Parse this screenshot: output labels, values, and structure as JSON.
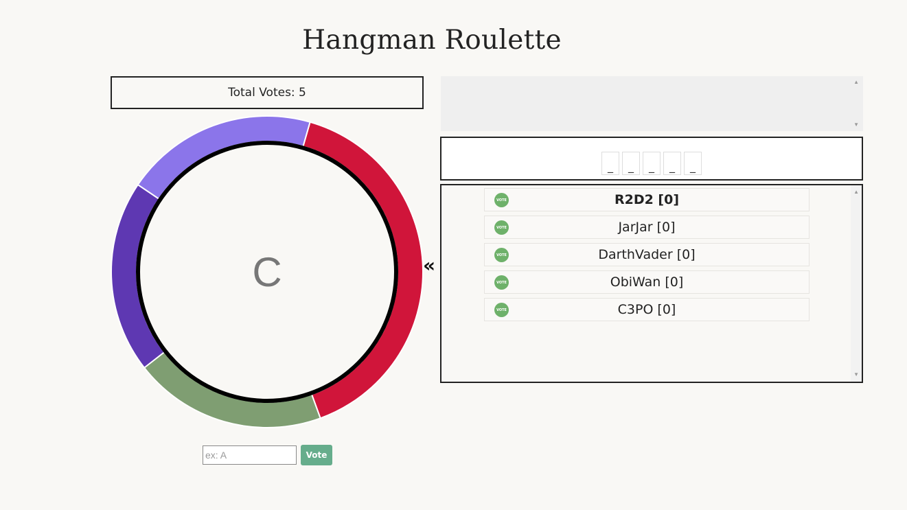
{
  "app": {
    "title": "Hangman Roulette"
  },
  "votes": {
    "total_label": "Total Votes: 5"
  },
  "wheel": {
    "current_letter": "C",
    "segments": [
      {
        "color": "#d0153a",
        "share": 0.4
      },
      {
        "color": "#7f9e72",
        "share": 0.2
      },
      {
        "color": "#5e38b2",
        "share": 0.2
      },
      {
        "color": "#8b75ea",
        "share": 0.2
      }
    ],
    "inner_ring_color": "#000000",
    "pointer_glyph": "«"
  },
  "vote_form": {
    "placeholder": "ex: A",
    "value": "",
    "button_label": "Vote"
  },
  "word": {
    "slots": [
      "_",
      "_",
      "_",
      "_",
      "_"
    ]
  },
  "players": {
    "badge_label": "VOTE",
    "items": [
      {
        "name": "R2D2 [0]",
        "highlight": true
      },
      {
        "name": "JarJar [0]",
        "highlight": false
      },
      {
        "name": "DarthVader [0]",
        "highlight": false
      },
      {
        "name": "ObiWan [0]",
        "highlight": false
      },
      {
        "name": "C3PO [0]",
        "highlight": false
      }
    ]
  },
  "colors": {
    "accent_button": "#66ad8c",
    "vote_badge": "#6eb16a",
    "background": "#f9f8f5"
  }
}
